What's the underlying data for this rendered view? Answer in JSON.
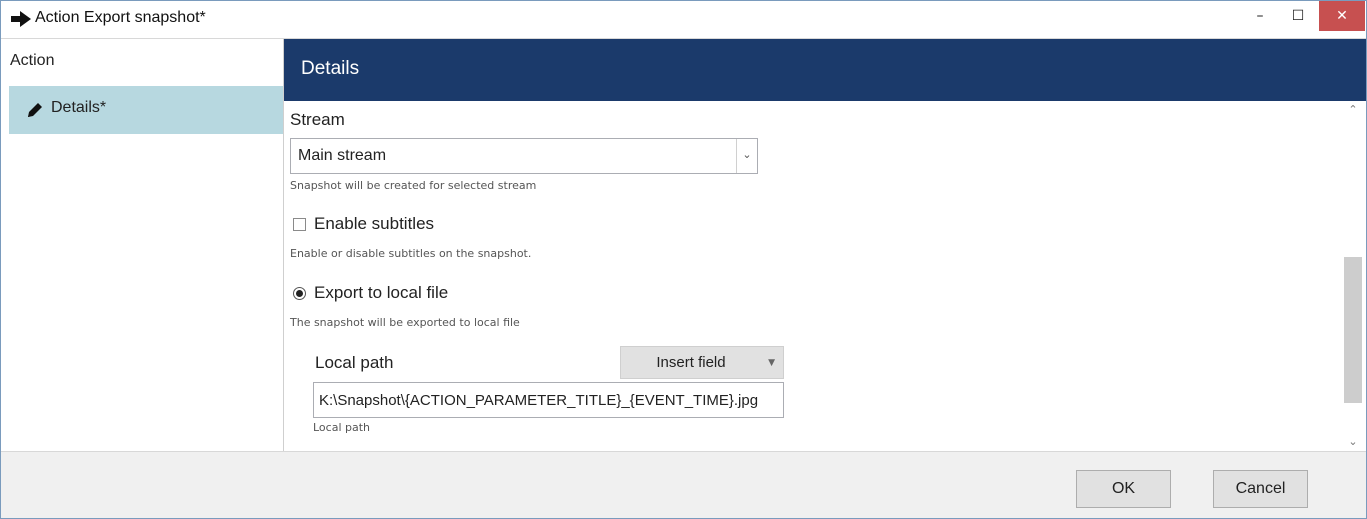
{
  "window": {
    "title": "Action Export snapshot*",
    "minimize_glyph": "–",
    "maximize_glyph": "☐",
    "close_glyph": "✕",
    "accent": "#1b3a6b",
    "close_color": "#c75050"
  },
  "sidebar": {
    "header": "Action",
    "items": [
      {
        "label": "Details*",
        "icon": "pencil-icon",
        "selected": true
      }
    ],
    "selected_color": "#b7d8e0"
  },
  "main": {
    "title": "Details",
    "stream": {
      "label": "Stream",
      "value": "Main stream",
      "hint": "Snapshot will be created for selected stream"
    },
    "subtitles": {
      "label": "Enable subtitles",
      "checked": false,
      "hint": "Enable or disable subtitles on the snapshot."
    },
    "export_local": {
      "label": "Export to local file",
      "selected": true,
      "hint": "The snapshot will be exported to local file"
    },
    "local_path": {
      "label": "Local path",
      "insert_field_label": "Insert field",
      "value": "K:\\Snapshot\\{ACTION_PARAMETER_TITLE}_{EVENT_TIME}.jpg",
      "hint": "Local path"
    }
  },
  "footer": {
    "ok_label": "OK",
    "cancel_label": "Cancel"
  }
}
